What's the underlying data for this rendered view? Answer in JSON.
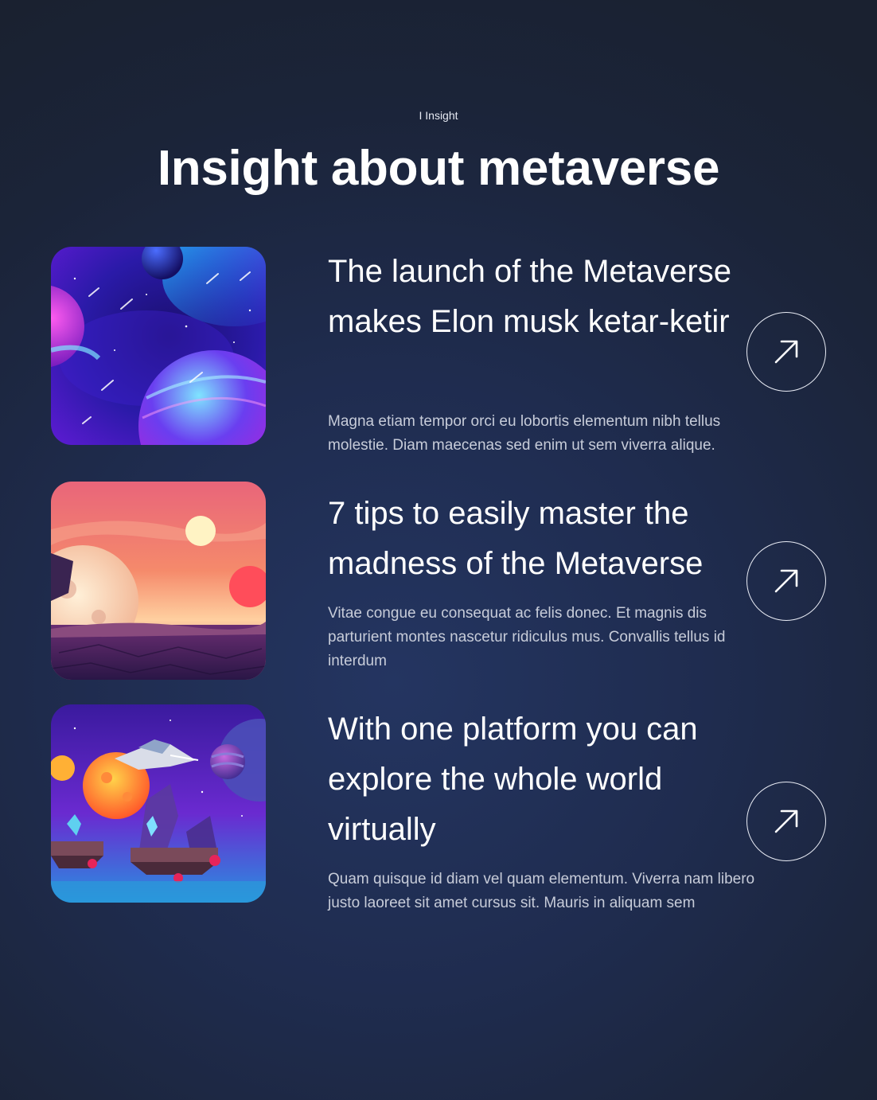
{
  "section": {
    "eyebrow": "I Insight",
    "title": "Insight about metaverse"
  },
  "articles": [
    {
      "title": "The launch of the Metaverse makes Elon musk ketar-ketir",
      "description": "Magna etiam tempor orci eu lobortis elementum nibh tellus molestie. Diam maecenas sed enim ut sem viverra alique.",
      "image": "space-planets-illustration",
      "button_icon": "arrow-up-right-icon"
    },
    {
      "title": "7 tips to easily master the madness of the Metaverse",
      "description": "Vitae congue eu consequat ac felis donec. Et magnis dis parturient montes nascetur ridiculus mus. Convallis tellus id interdum",
      "image": "alien-sunset-illustration",
      "button_icon": "arrow-up-right-icon"
    },
    {
      "title": "With one platform you can explore the whole world virtually",
      "description": "Quam quisque id diam vel quam elementum. Viverra nam libero justo laoreet sit amet cursus sit. Mauris in aliquam sem",
      "image": "fantasy-game-world-illustration",
      "button_icon": "arrow-up-right-icon"
    }
  ]
}
